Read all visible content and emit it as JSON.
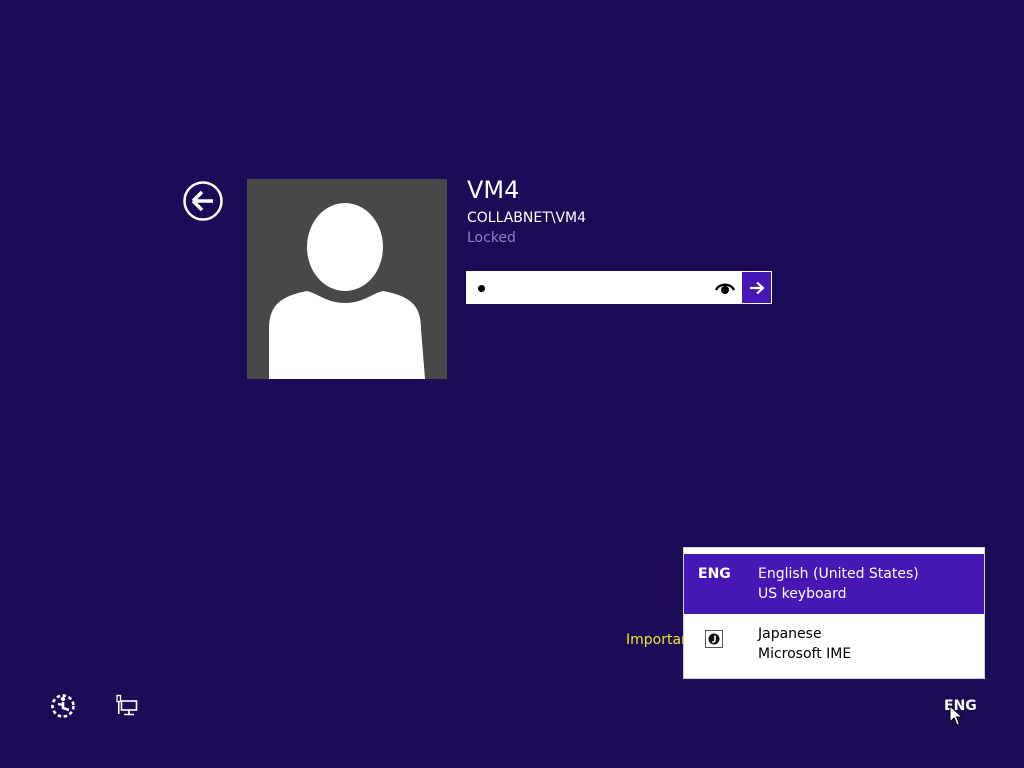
{
  "colors": {
    "background": "#1b0b57",
    "accent": "#4617b4",
    "avatar_tile": "#484848",
    "status_text": "#8c7fcf",
    "warning_text": "#f0e62b"
  },
  "icons": {
    "back": "back-arrow-icon",
    "reveal": "eye-icon",
    "submit": "arrow-right-icon",
    "ease_of_access": "ease-of-access-icon",
    "network": "network-icon",
    "ime": "japanese-ime-icon"
  },
  "user": {
    "name": "VM4",
    "account": "COLLABNET\\VM4",
    "status": "Locked"
  },
  "password": {
    "masked_length": 1
  },
  "notice": {
    "text": "Importar"
  },
  "language_menu": {
    "items": [
      {
        "code": "ENG",
        "name": "English (United States)",
        "layout": "US keyboard",
        "selected": true
      },
      {
        "code": "",
        "name": "Japanese",
        "layout": "Microsoft IME",
        "selected": false
      }
    ]
  },
  "taskbar": {
    "input_indicator": "ENG"
  }
}
